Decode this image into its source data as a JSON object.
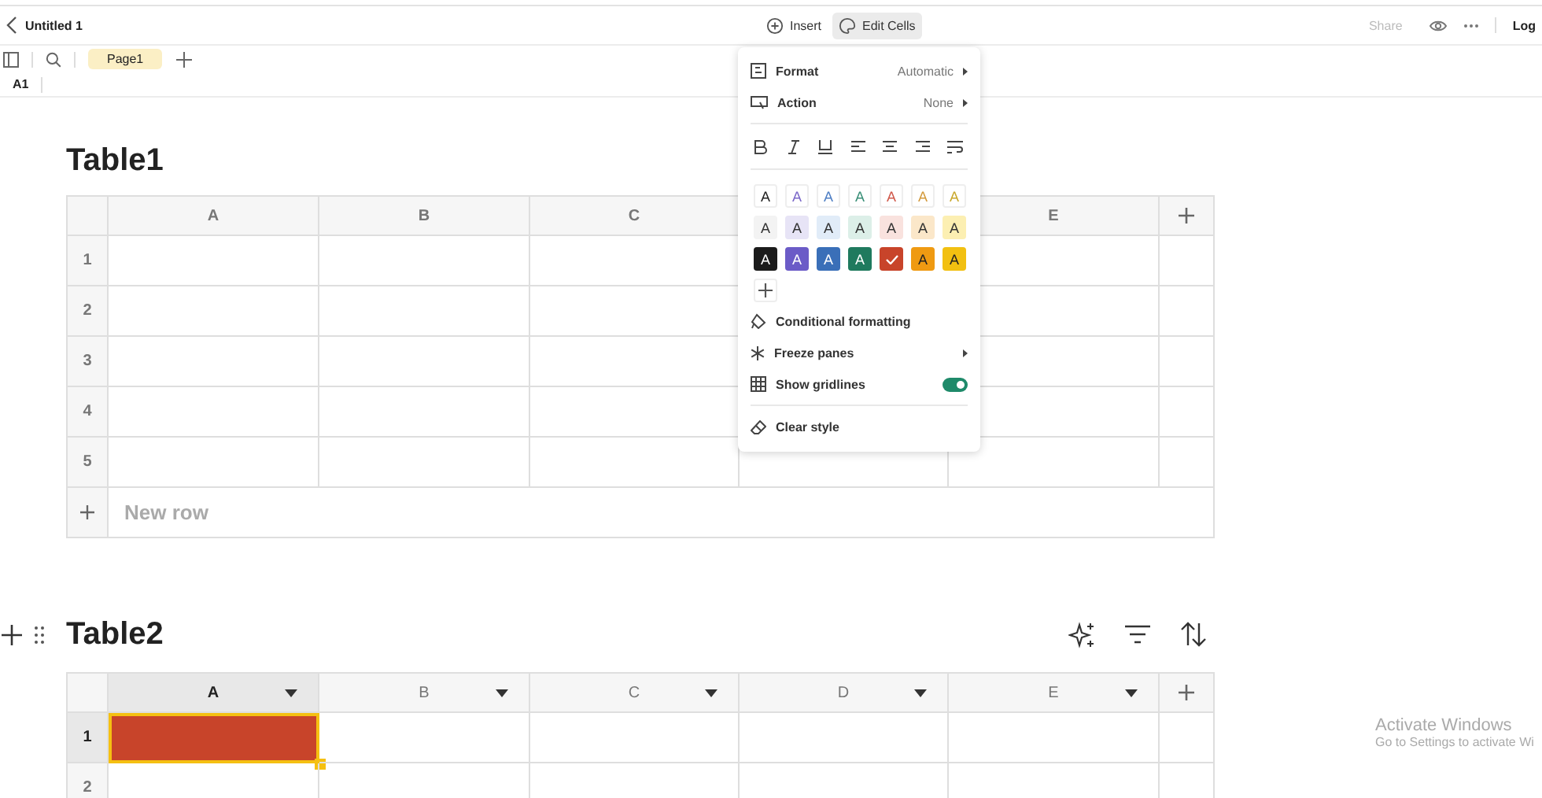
{
  "topbar": {
    "title": "Untitled 1",
    "insert": "Insert",
    "edit_cells": {
      "label": "Edit Cells",
      "selected": true
    },
    "share": {
      "label": "Share",
      "disabled": true
    },
    "login": "Log"
  },
  "pages": [
    {
      "label": "Page1",
      "selected": true
    }
  ],
  "cell_reference": "A1",
  "menu": {
    "rows": [
      {
        "kind": "value",
        "label": "Format",
        "value": "Automatic"
      },
      {
        "kind": "value",
        "label": "Action",
        "value": "None"
      }
    ],
    "swatches": [
      {
        "kind": "text",
        "label": "A",
        "color": "#222222",
        "selected": false
      },
      {
        "kind": "text",
        "label": "A",
        "color": "#7b68c9",
        "selected": false
      },
      {
        "kind": "text",
        "label": "A",
        "color": "#4f7fc4",
        "selected": false
      },
      {
        "kind": "text",
        "label": "A",
        "color": "#3a8f78",
        "selected": false
      },
      {
        "kind": "text",
        "label": "A",
        "color": "#d0584a",
        "selected": false
      },
      {
        "kind": "text",
        "label": "A",
        "color": "#d39a3c",
        "selected": false
      },
      {
        "kind": "text",
        "label": "A",
        "color": "#c9a82c",
        "selected": false
      },
      {
        "kind": "fill",
        "label": "A",
        "color": "#f3f3f3",
        "selected": false
      },
      {
        "kind": "fill",
        "label": "A",
        "color": "#e7e4f6",
        "selected": false
      },
      {
        "kind": "fill",
        "label": "A",
        "color": "#e1ecf8",
        "selected": false
      },
      {
        "kind": "fill",
        "label": "A",
        "color": "#dcefe8",
        "selected": false
      },
      {
        "kind": "fill",
        "label": "A",
        "color": "#f9e2de",
        "selected": false
      },
      {
        "kind": "fill",
        "label": "A",
        "color": "#fbe7c9",
        "selected": false
      },
      {
        "kind": "fill",
        "label": "A",
        "color": "#fcefb2",
        "selected": false
      },
      {
        "kind": "solid",
        "label": "A",
        "color": "#1b1b1b",
        "selected": false
      },
      {
        "kind": "solid",
        "label": "A",
        "color": "#6b5bc7",
        "selected": false
      },
      {
        "kind": "solid",
        "label": "A",
        "color": "#3a6fb8",
        "selected": false
      },
      {
        "kind": "solid",
        "label": "A",
        "color": "#1f7a5e",
        "selected": false
      },
      {
        "kind": "solid",
        "color": "#c8442a",
        "selected": true
      },
      {
        "kind": "solid",
        "label": "A",
        "color": "#ef9a12",
        "selected": false
      },
      {
        "kind": "solid",
        "label": "A",
        "color": "#f2c011",
        "selected": false
      }
    ],
    "items": [
      {
        "kind": "conditional",
        "label": "Conditional formatting"
      },
      {
        "kind": "freeze",
        "label": "Freeze panes",
        "submenu": true
      },
      {
        "kind": "gridlines",
        "label": "Show gridlines",
        "on": true
      }
    ],
    "clear": "Clear style"
  },
  "table1": {
    "title": "Table1",
    "columns": [
      {
        "label": "A"
      },
      {
        "label": "B"
      },
      {
        "label": "C"
      },
      {},
      {
        "label": "E"
      }
    ],
    "rows": [
      "1",
      "2",
      "3",
      "4",
      "5"
    ],
    "new_row": "New row"
  },
  "table2": {
    "title": "Table2",
    "columns": [
      {
        "label": "A",
        "selected": true
      },
      {
        "label": "B",
        "selected": false
      },
      {
        "label": "C",
        "selected": false
      },
      {
        "label": "D",
        "selected": false
      },
      {
        "label": "E",
        "selected": false
      }
    ],
    "rows": [
      {
        "number": "1",
        "cells": [
          {
            "selected": true,
            "color": "#c8442a"
          },
          {
            "selected": false
          },
          {
            "selected": false
          },
          {
            "selected": false
          },
          {
            "selected": false
          }
        ]
      },
      {
        "number": "2",
        "cells": [
          {
            "selected": false
          },
          {
            "selected": false
          },
          {
            "selected": false
          },
          {
            "selected": false
          },
          {
            "selected": false
          }
        ]
      }
    ]
  },
  "os_notice": {
    "title": "Activate Windows",
    "subtitle": "Go to Settings to activate Wi"
  }
}
